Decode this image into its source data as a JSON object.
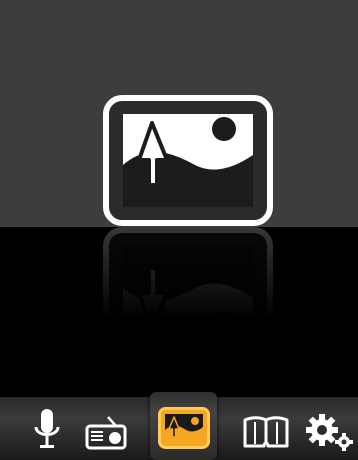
{
  "screen": {
    "title": "",
    "selected_menu": "pictures",
    "colors": {
      "top_panel": "#3d3d3d",
      "background": "#000000",
      "icon_white": "#ffffff",
      "accent_orange": "#f5a623",
      "bar": "#2f2f2f"
    }
  },
  "menu": {
    "items": [
      {
        "id": "voice",
        "icon": "microphone-icon",
        "selected": false
      },
      {
        "id": "radio",
        "icon": "radio-icon",
        "selected": false
      },
      {
        "id": "pictures",
        "icon": "picture-icon",
        "selected": true
      },
      {
        "id": "ebook",
        "icon": "book-icon",
        "selected": false
      },
      {
        "id": "settings",
        "icon": "gear-icon",
        "selected": false
      }
    ]
  }
}
